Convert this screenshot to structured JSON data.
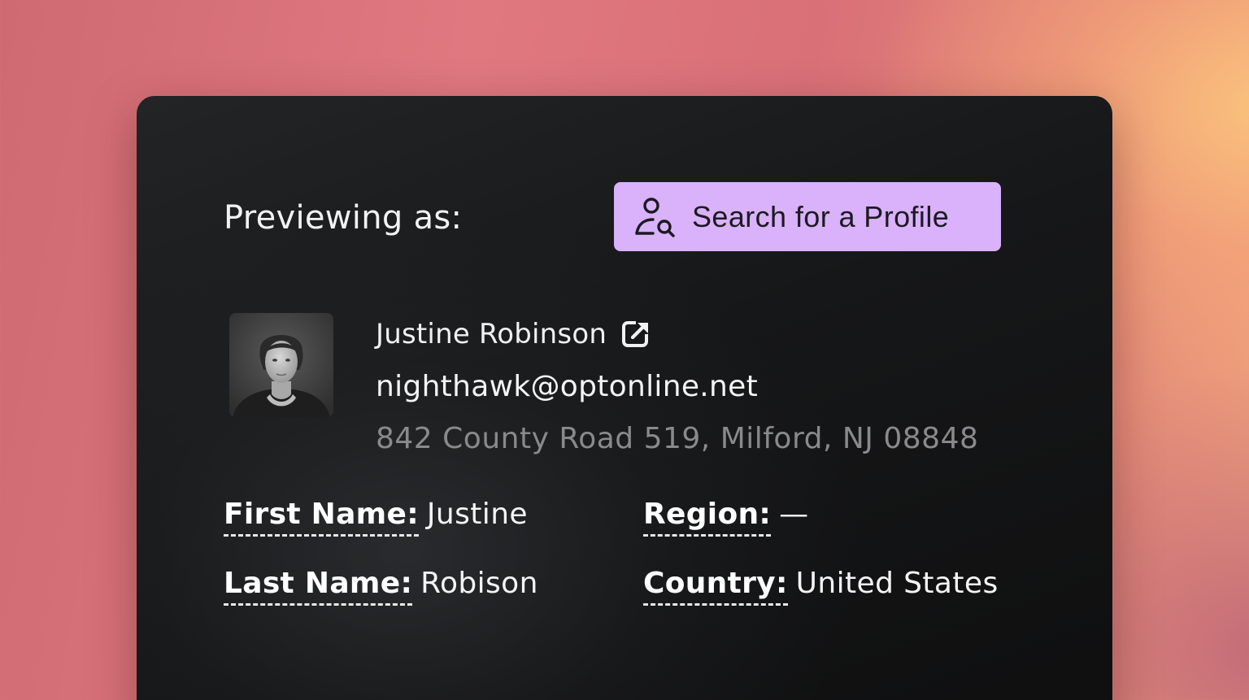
{
  "header": {
    "previewing_label": "Previewing as:",
    "search_button_label": "Search for a Profile"
  },
  "profile": {
    "name": "Justine Robinson",
    "email": "nighthawk@optonline.net",
    "address": "842 County Road 519, Milford, NJ 08848"
  },
  "fields": {
    "first_name": {
      "label": "First Name:",
      "value": "Justine"
    },
    "last_name": {
      "label": "Last Name:",
      "value": "Robison"
    },
    "region": {
      "label": "Region:",
      "value": "—"
    },
    "country": {
      "label": "Country:",
      "value": "United States"
    }
  },
  "icons": {
    "search_button_icon": "user-search-icon",
    "name_link_icon": "external-link-icon"
  },
  "colors": {
    "button_bg": "#d9b2fb",
    "card_bg": "#161718",
    "address_text": "#8a8a8c"
  }
}
